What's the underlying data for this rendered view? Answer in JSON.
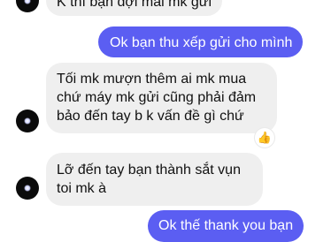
{
  "messages": [
    {
      "side": "in",
      "lines": [
        "K thì bạn đợi mai mk gửi"
      ]
    },
    {
      "side": "out",
      "lines": [
        "Ok bạn thu xếp gửi cho mình"
      ]
    },
    {
      "side": "in",
      "lines": [
        "Tối mk mượn thêm ai mk mua",
        "chứ máy mk gửi cũng phải đảm",
        "bảo đến tay b k vấn đề gì chứ"
      ],
      "reaction": "👍"
    },
    {
      "side": "in",
      "lines": [
        "Lỡ đến tay bạn thành sắt vụn",
        "toi mk à"
      ]
    },
    {
      "side": "out",
      "lines": [
        "Ok thế thank you bạn"
      ]
    }
  ],
  "colors": {
    "incoming_bg": "#efefef",
    "outgoing_bg": "#5b5ef2"
  },
  "icons": {
    "avatar": "avatar-dark-icon",
    "reaction": "thumbs-up-icon"
  }
}
